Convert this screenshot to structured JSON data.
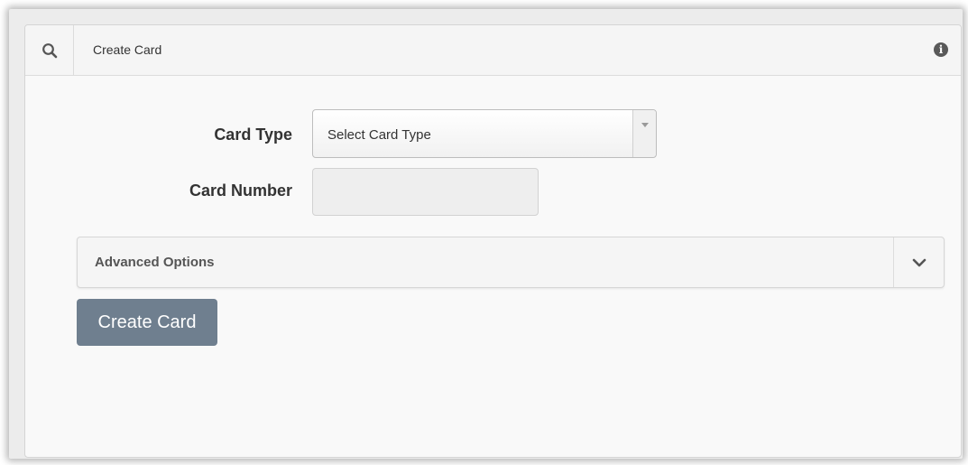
{
  "header": {
    "title": "Create Card",
    "search_icon": "search-icon",
    "info_icon": "info-icon"
  },
  "form": {
    "card_type_label": "Card Type",
    "card_type_select": {
      "value": "Select Card Type",
      "icon": "caret-down-icon"
    },
    "card_number_label": "Card Number",
    "card_number_value": ""
  },
  "advanced": {
    "label": "Advanced Options",
    "icon": "chevron-down-icon"
  },
  "actions": {
    "create_label": "Create Card"
  },
  "colors": {
    "create_button_bg": "#6f7f8f",
    "panel_bg": "#f9f9f9"
  }
}
